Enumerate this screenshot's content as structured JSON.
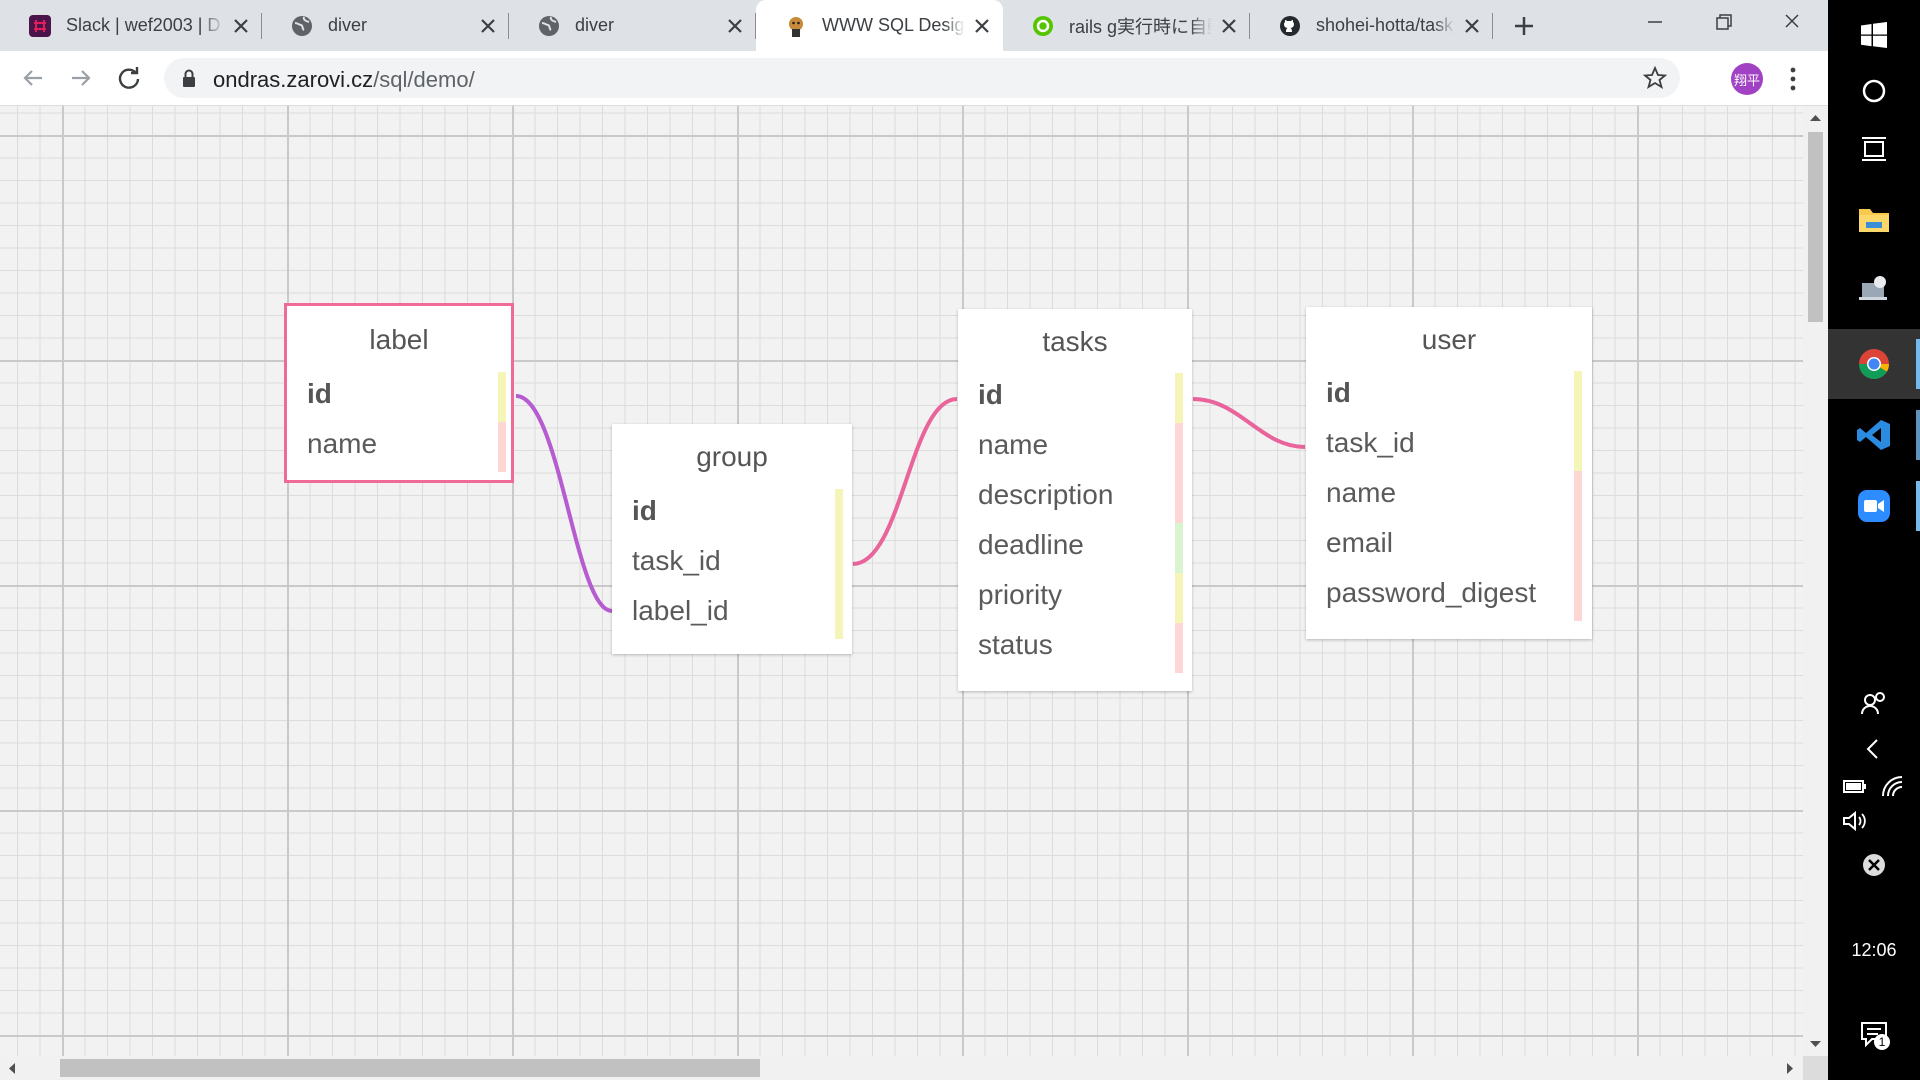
{
  "browser": {
    "tabs": [
      {
        "title": "Slack | wef2003 | D",
        "favicon": "slack-icon",
        "active": false
      },
      {
        "title": "diver",
        "favicon": "globe-icon",
        "active": false
      },
      {
        "title": "diver",
        "favicon": "globe-icon",
        "active": false
      },
      {
        "title": "WWW SQL Designer",
        "favicon": "sql-designer-icon",
        "active": true
      },
      {
        "title": "rails g実行時に自動",
        "favicon": "qiita-icon",
        "active": false
      },
      {
        "title": "shohei-hotta/task_",
        "favicon": "github-icon",
        "active": false
      }
    ],
    "url_host": "ondras.zarovi.cz",
    "url_path": "/sql/demo/",
    "profile_initials": "翔平"
  },
  "designer": {
    "tables": [
      {
        "name": "label",
        "selected": true,
        "rows": [
          {
            "name": "id",
            "pk": true,
            "color": "#f5f5b8"
          },
          {
            "name": "name",
            "pk": false,
            "color": "#ffd6d6"
          }
        ]
      },
      {
        "name": "group",
        "selected": false,
        "rows": [
          {
            "name": "id",
            "pk": true,
            "color": "#f5f5b8"
          },
          {
            "name": "task_id",
            "pk": false,
            "color": "#f5f5b8"
          },
          {
            "name": "label_id",
            "pk": false,
            "color": "#f5f5b8"
          }
        ]
      },
      {
        "name": "tasks",
        "selected": false,
        "rows": [
          {
            "name": "id",
            "pk": true,
            "color": "#f5f5b8"
          },
          {
            "name": "name",
            "pk": false,
            "color": "#ffd6d6"
          },
          {
            "name": "description",
            "pk": false,
            "color": "#ffd6d6"
          },
          {
            "name": "deadline",
            "pk": false,
            "color": "#d8f5d0"
          },
          {
            "name": "priority",
            "pk": false,
            "color": "#f5f5b8"
          },
          {
            "name": "status",
            "pk": false,
            "color": "#ffd6d6"
          }
        ]
      },
      {
        "name": "user",
        "selected": false,
        "rows": [
          {
            "name": "id",
            "pk": true,
            "color": "#f5f5b8"
          },
          {
            "name": "task_id",
            "pk": false,
            "color": "#f5f5b8"
          },
          {
            "name": "name",
            "pk": false,
            "color": "#ffd6d6"
          },
          {
            "name": "email",
            "pk": false,
            "color": "#ffd6d6"
          },
          {
            "name": "password_digest",
            "pk": false,
            "color": "#ffd6d6"
          }
        ]
      }
    ],
    "relations": [
      {
        "from": "label.id",
        "to": "group.label_id",
        "color": "#b65bd0"
      },
      {
        "from": "tasks.id",
        "to": "group.task_id",
        "color": "#e8649a"
      },
      {
        "from": "tasks.id",
        "to": "user.task_id",
        "color": "#e8649a"
      }
    ]
  },
  "taskbar": {
    "time": "12:06",
    "notification_count": "1",
    "items": [
      "windows-start-icon",
      "cortana-icon",
      "task-view-icon",
      "file-explorer-icon",
      "remote-desktop-icon",
      "chrome-icon",
      "vscode-icon",
      "zoom-icon"
    ]
  }
}
